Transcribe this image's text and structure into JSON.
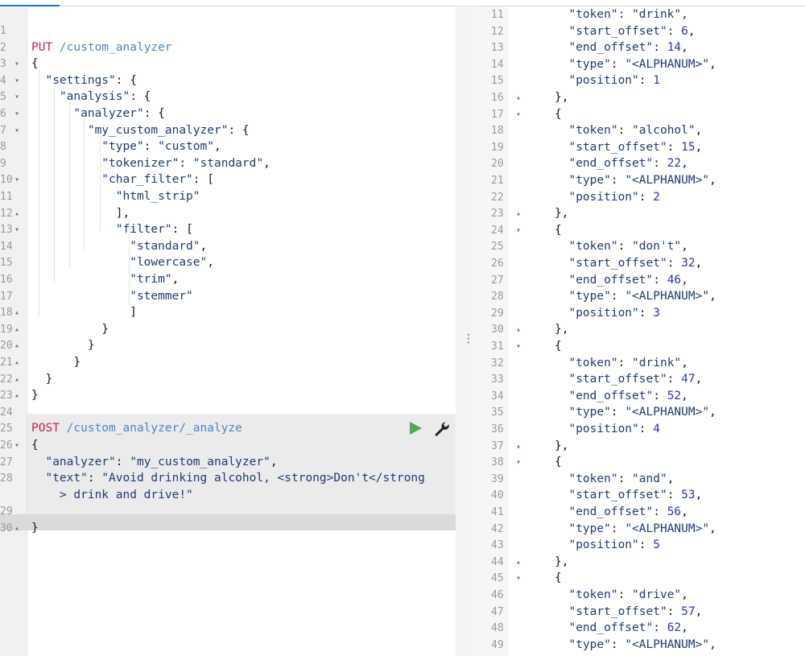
{
  "request_editor": {
    "lines": [
      {
        "n": "1",
        "fold": "",
        "segs": []
      },
      {
        "n": "2",
        "fold": "",
        "segs": [
          {
            "t": "PUT",
            "c": "method"
          },
          {
            "t": " /custom_analyzer",
            "c": "path"
          }
        ]
      },
      {
        "n": "3",
        "fold": "▾",
        "segs": [
          {
            "t": "{",
            "c": "pun"
          }
        ]
      },
      {
        "n": "4",
        "fold": "▾",
        "segs": [
          {
            "t": "  \"settings\"",
            "c": "key"
          },
          {
            "t": ": {",
            "c": "pun"
          }
        ]
      },
      {
        "n": "5",
        "fold": "▾",
        "segs": [
          {
            "t": "    \"analysis\"",
            "c": "key"
          },
          {
            "t": ": {",
            "c": "pun"
          }
        ]
      },
      {
        "n": "6",
        "fold": "▾",
        "segs": [
          {
            "t": "      \"analyzer\"",
            "c": "key"
          },
          {
            "t": ": {",
            "c": "pun"
          }
        ]
      },
      {
        "n": "7",
        "fold": "▾",
        "segs": [
          {
            "t": "        \"my_custom_analyzer\"",
            "c": "key"
          },
          {
            "t": ": {",
            "c": "pun"
          }
        ]
      },
      {
        "n": "8",
        "fold": "",
        "segs": [
          {
            "t": "          \"type\"",
            "c": "key"
          },
          {
            "t": ": ",
            "c": "pun"
          },
          {
            "t": "\"custom\"",
            "c": "str"
          },
          {
            "t": ",",
            "c": "pun"
          }
        ]
      },
      {
        "n": "9",
        "fold": "",
        "segs": [
          {
            "t": "          \"tokenizer\"",
            "c": "key"
          },
          {
            "t": ": ",
            "c": "pun"
          },
          {
            "t": "\"standard\"",
            "c": "str"
          },
          {
            "t": ",",
            "c": "pun"
          }
        ]
      },
      {
        "n": "10",
        "fold": "▾",
        "segs": [
          {
            "t": "          \"char_filter\"",
            "c": "key"
          },
          {
            "t": ": [",
            "c": "pun"
          }
        ]
      },
      {
        "n": "11",
        "fold": "",
        "segs": [
          {
            "t": "            \"html_strip\"",
            "c": "str"
          }
        ]
      },
      {
        "n": "12",
        "fold": "▴",
        "segs": [
          {
            "t": "            ],",
            "c": "pun"
          }
        ]
      },
      {
        "n": "13",
        "fold": "▾",
        "segs": [
          {
            "t": "            \"filter\"",
            "c": "key"
          },
          {
            "t": ": [",
            "c": "pun"
          }
        ]
      },
      {
        "n": "14",
        "fold": "",
        "segs": [
          {
            "t": "              \"standard\"",
            "c": "str"
          },
          {
            "t": ",",
            "c": "pun"
          }
        ]
      },
      {
        "n": "15",
        "fold": "",
        "segs": [
          {
            "t": "              \"lowercase\"",
            "c": "str"
          },
          {
            "t": ",",
            "c": "pun"
          }
        ]
      },
      {
        "n": "16",
        "fold": "",
        "segs": [
          {
            "t": "              \"trim\"",
            "c": "str"
          },
          {
            "t": ",",
            "c": "pun"
          }
        ]
      },
      {
        "n": "17",
        "fold": "",
        "segs": [
          {
            "t": "              \"stemmer\"",
            "c": "str"
          }
        ]
      },
      {
        "n": "18",
        "fold": "▴",
        "segs": [
          {
            "t": "              ]",
            "c": "pun"
          }
        ]
      },
      {
        "n": "19",
        "fold": "▴",
        "segs": [
          {
            "t": "          }",
            "c": "pun"
          }
        ]
      },
      {
        "n": "20",
        "fold": "▴",
        "segs": [
          {
            "t": "        }",
            "c": "pun"
          }
        ]
      },
      {
        "n": "21",
        "fold": "▴",
        "segs": [
          {
            "t": "      }",
            "c": "pun"
          }
        ]
      },
      {
        "n": "22",
        "fold": "▴",
        "segs": [
          {
            "t": "  }",
            "c": "pun"
          }
        ]
      },
      {
        "n": "23",
        "fold": "▴",
        "segs": [
          {
            "t": "}",
            "c": "pun"
          }
        ]
      },
      {
        "n": "24",
        "fold": "",
        "segs": []
      },
      {
        "n": "25",
        "fold": "",
        "segs": [
          {
            "t": "POST",
            "c": "method"
          },
          {
            "t": " /custom_analyzer/_analyze",
            "c": "path"
          }
        ]
      },
      {
        "n": "26",
        "fold": "▾",
        "segs": [
          {
            "t": "{",
            "c": "pun"
          }
        ]
      },
      {
        "n": "27",
        "fold": "",
        "segs": [
          {
            "t": "  \"analyzer\"",
            "c": "key"
          },
          {
            "t": ": ",
            "c": "pun"
          },
          {
            "t": "\"my_custom_analyzer\"",
            "c": "str"
          },
          {
            "t": ",",
            "c": "pun"
          }
        ]
      },
      {
        "n": "28",
        "fold": "",
        "segs": [
          {
            "t": "  \"text\"",
            "c": "key"
          },
          {
            "t": ": ",
            "c": "pun"
          },
          {
            "t": "\"Avoid drinking alcohol, <strong>Don't</strong",
            "c": "str"
          }
        ]
      },
      {
        "n": "",
        "fold": "",
        "segs": [
          {
            "t": "    > drink and drive!\"",
            "c": "str"
          }
        ]
      },
      {
        "n": "29",
        "fold": "",
        "segs": []
      },
      {
        "n": "30",
        "fold": "▴",
        "segs": [
          {
            "t": "}",
            "c": "pun"
          }
        ]
      }
    ],
    "icons": {
      "run": "play-icon",
      "settings": "wrench-icon"
    },
    "colors": {
      "method": "#c7254e",
      "path": "#4a86c5",
      "run": "#4ab048"
    }
  },
  "response_viewer": {
    "lines": [
      {
        "n": "11",
        "fold": "",
        "segs": [
          {
            "t": "  \"token\": \"drink\",",
            "c": "str"
          }
        ]
      },
      {
        "n": "12",
        "fold": "",
        "segs": [
          {
            "t": "  \"start_offset\"",
            "c": "key"
          },
          {
            "t": ": ",
            "c": "pun"
          },
          {
            "t": "6",
            "c": "num"
          },
          {
            "t": ",",
            "c": "pun"
          }
        ]
      },
      {
        "n": "13",
        "fold": "",
        "segs": [
          {
            "t": "  \"end_offset\"",
            "c": "key"
          },
          {
            "t": ": ",
            "c": "pun"
          },
          {
            "t": "14",
            "c": "num"
          },
          {
            "t": ",",
            "c": "pun"
          }
        ]
      },
      {
        "n": "14",
        "fold": "",
        "segs": [
          {
            "t": "  \"type\"",
            "c": "key"
          },
          {
            "t": ": ",
            "c": "pun"
          },
          {
            "t": "\"<ALPHANUM>\"",
            "c": "str"
          },
          {
            "t": ",",
            "c": "pun"
          }
        ]
      },
      {
        "n": "15",
        "fold": "",
        "segs": [
          {
            "t": "  \"position\"",
            "c": "key"
          },
          {
            "t": ": ",
            "c": "pun"
          },
          {
            "t": "1",
            "c": "num"
          }
        ]
      },
      {
        "n": "16",
        "fold": "▴",
        "segs": [
          {
            "t": "},",
            "c": "pun"
          }
        ]
      },
      {
        "n": "17",
        "fold": "▾",
        "segs": [
          {
            "t": "{",
            "c": "pun"
          }
        ]
      },
      {
        "n": "18",
        "fold": "",
        "segs": [
          {
            "t": "  \"token\"",
            "c": "key"
          },
          {
            "t": ": ",
            "c": "pun"
          },
          {
            "t": "\"alcohol\"",
            "c": "str"
          },
          {
            "t": ",",
            "c": "pun"
          }
        ]
      },
      {
        "n": "19",
        "fold": "",
        "segs": [
          {
            "t": "  \"start_offset\"",
            "c": "key"
          },
          {
            "t": ": ",
            "c": "pun"
          },
          {
            "t": "15",
            "c": "num"
          },
          {
            "t": ",",
            "c": "pun"
          }
        ]
      },
      {
        "n": "20",
        "fold": "",
        "segs": [
          {
            "t": "  \"end_offset\"",
            "c": "key"
          },
          {
            "t": ": ",
            "c": "pun"
          },
          {
            "t": "22",
            "c": "num"
          },
          {
            "t": ",",
            "c": "pun"
          }
        ]
      },
      {
        "n": "21",
        "fold": "",
        "segs": [
          {
            "t": "  \"type\"",
            "c": "key"
          },
          {
            "t": ": ",
            "c": "pun"
          },
          {
            "t": "\"<ALPHANUM>\"",
            "c": "str"
          },
          {
            "t": ",",
            "c": "pun"
          }
        ]
      },
      {
        "n": "22",
        "fold": "",
        "segs": [
          {
            "t": "  \"position\"",
            "c": "key"
          },
          {
            "t": ": ",
            "c": "pun"
          },
          {
            "t": "2",
            "c": "num"
          }
        ]
      },
      {
        "n": "23",
        "fold": "▴",
        "segs": [
          {
            "t": "},",
            "c": "pun"
          }
        ]
      },
      {
        "n": "24",
        "fold": "▾",
        "segs": [
          {
            "t": "{",
            "c": "pun"
          }
        ]
      },
      {
        "n": "25",
        "fold": "",
        "segs": [
          {
            "t": "  \"token\"",
            "c": "key"
          },
          {
            "t": ": ",
            "c": "pun"
          },
          {
            "t": "\"don't\"",
            "c": "str"
          },
          {
            "t": ",",
            "c": "pun"
          }
        ]
      },
      {
        "n": "26",
        "fold": "",
        "segs": [
          {
            "t": "  \"start_offset\"",
            "c": "key"
          },
          {
            "t": ": ",
            "c": "pun"
          },
          {
            "t": "32",
            "c": "num"
          },
          {
            "t": ",",
            "c": "pun"
          }
        ]
      },
      {
        "n": "27",
        "fold": "",
        "segs": [
          {
            "t": "  \"end_offset\"",
            "c": "key"
          },
          {
            "t": ": ",
            "c": "pun"
          },
          {
            "t": "46",
            "c": "num"
          },
          {
            "t": ",",
            "c": "pun"
          }
        ]
      },
      {
        "n": "28",
        "fold": "",
        "segs": [
          {
            "t": "  \"type\"",
            "c": "key"
          },
          {
            "t": ": ",
            "c": "pun"
          },
          {
            "t": "\"<ALPHANUM>\"",
            "c": "str"
          },
          {
            "t": ",",
            "c": "pun"
          }
        ]
      },
      {
        "n": "29",
        "fold": "",
        "segs": [
          {
            "t": "  \"position\"",
            "c": "key"
          },
          {
            "t": ": ",
            "c": "pun"
          },
          {
            "t": "3",
            "c": "num"
          }
        ]
      },
      {
        "n": "30",
        "fold": "▴",
        "segs": [
          {
            "t": "},",
            "c": "pun"
          }
        ]
      },
      {
        "n": "31",
        "fold": "▾",
        "segs": [
          {
            "t": "{",
            "c": "pun"
          }
        ]
      },
      {
        "n": "32",
        "fold": "",
        "segs": [
          {
            "t": "  \"token\"",
            "c": "key"
          },
          {
            "t": ": ",
            "c": "pun"
          },
          {
            "t": "\"drink\"",
            "c": "str"
          },
          {
            "t": ",",
            "c": "pun"
          }
        ]
      },
      {
        "n": "33",
        "fold": "",
        "segs": [
          {
            "t": "  \"start_offset\"",
            "c": "key"
          },
          {
            "t": ": ",
            "c": "pun"
          },
          {
            "t": "47",
            "c": "num"
          },
          {
            "t": ",",
            "c": "pun"
          }
        ]
      },
      {
        "n": "34",
        "fold": "",
        "segs": [
          {
            "t": "  \"end_offset\"",
            "c": "key"
          },
          {
            "t": ": ",
            "c": "pun"
          },
          {
            "t": "52",
            "c": "num"
          },
          {
            "t": ",",
            "c": "pun"
          }
        ]
      },
      {
        "n": "35",
        "fold": "",
        "segs": [
          {
            "t": "  \"type\"",
            "c": "key"
          },
          {
            "t": ": ",
            "c": "pun"
          },
          {
            "t": "\"<ALPHANUM>\"",
            "c": "str"
          },
          {
            "t": ",",
            "c": "pun"
          }
        ]
      },
      {
        "n": "36",
        "fold": "",
        "segs": [
          {
            "t": "  \"position\"",
            "c": "key"
          },
          {
            "t": ": ",
            "c": "pun"
          },
          {
            "t": "4",
            "c": "num"
          }
        ]
      },
      {
        "n": "37",
        "fold": "▴",
        "segs": [
          {
            "t": "},",
            "c": "pun"
          }
        ]
      },
      {
        "n": "38",
        "fold": "▾",
        "segs": [
          {
            "t": "{",
            "c": "pun"
          }
        ]
      },
      {
        "n": "39",
        "fold": "",
        "segs": [
          {
            "t": "  \"token\"",
            "c": "key"
          },
          {
            "t": ": ",
            "c": "pun"
          },
          {
            "t": "\"and\"",
            "c": "str"
          },
          {
            "t": ",",
            "c": "pun"
          }
        ]
      },
      {
        "n": "40",
        "fold": "",
        "segs": [
          {
            "t": "  \"start_offset\"",
            "c": "key"
          },
          {
            "t": ": ",
            "c": "pun"
          },
          {
            "t": "53",
            "c": "num"
          },
          {
            "t": ",",
            "c": "pun"
          }
        ]
      },
      {
        "n": "41",
        "fold": "",
        "segs": [
          {
            "t": "  \"end_offset\"",
            "c": "key"
          },
          {
            "t": ": ",
            "c": "pun"
          },
          {
            "t": "56",
            "c": "num"
          },
          {
            "t": ",",
            "c": "pun"
          }
        ]
      },
      {
        "n": "42",
        "fold": "",
        "segs": [
          {
            "t": "  \"type\"",
            "c": "key"
          },
          {
            "t": ": ",
            "c": "pun"
          },
          {
            "t": "\"<ALPHANUM>\"",
            "c": "str"
          },
          {
            "t": ",",
            "c": "pun"
          }
        ]
      },
      {
        "n": "43",
        "fold": "",
        "segs": [
          {
            "t": "  \"position\"",
            "c": "key"
          },
          {
            "t": ": ",
            "c": "pun"
          },
          {
            "t": "5",
            "c": "num"
          }
        ]
      },
      {
        "n": "44",
        "fold": "▴",
        "segs": [
          {
            "t": "},",
            "c": "pun"
          }
        ]
      },
      {
        "n": "45",
        "fold": "▾",
        "segs": [
          {
            "t": "{",
            "c": "pun"
          }
        ]
      },
      {
        "n": "46",
        "fold": "",
        "segs": [
          {
            "t": "  \"token\"",
            "c": "key"
          },
          {
            "t": ": ",
            "c": "pun"
          },
          {
            "t": "\"drive\"",
            "c": "str"
          },
          {
            "t": ",",
            "c": "pun"
          }
        ]
      },
      {
        "n": "47",
        "fold": "",
        "segs": [
          {
            "t": "  \"start_offset\"",
            "c": "key"
          },
          {
            "t": ": ",
            "c": "pun"
          },
          {
            "t": "57",
            "c": "num"
          },
          {
            "t": ",",
            "c": "pun"
          }
        ]
      },
      {
        "n": "48",
        "fold": "",
        "segs": [
          {
            "t": "  \"end_offset\"",
            "c": "key"
          },
          {
            "t": ": ",
            "c": "pun"
          },
          {
            "t": "62",
            "c": "num"
          },
          {
            "t": ",",
            "c": "pun"
          }
        ]
      },
      {
        "n": "49",
        "fold": "",
        "segs": [
          {
            "t": "  \"type\"",
            "c": "key"
          },
          {
            "t": ": ",
            "c": "pun"
          },
          {
            "t": "\"<ALPHANUM>\"",
            "c": "str"
          },
          {
            "t": ",",
            "c": "pun"
          }
        ]
      }
    ]
  },
  "splitter": {
    "grip": "⋮"
  }
}
